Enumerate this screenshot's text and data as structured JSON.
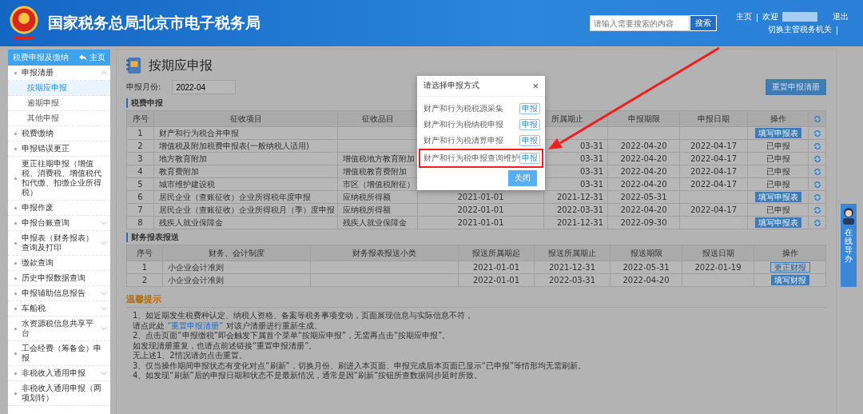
{
  "header": {
    "title": "国家税务总局北京市电子税务局",
    "search": {
      "placeholder": "请输入需要搜索的内容",
      "button": "搜索"
    },
    "links": {
      "home": "主页",
      "welcome": "欢迎",
      "logout": "退出",
      "switch": "切换主管税务机关",
      "separator": "|"
    }
  },
  "sidebar": {
    "title": "税费申报及缴纳",
    "home": "主页",
    "items": [
      {
        "label": "申报清册",
        "kind": "group",
        "expanded": true,
        "children": [
          {
            "label": "按期应申报",
            "selected": true
          },
          {
            "label": "逾期申报",
            "selected": false
          },
          {
            "label": "其他申报",
            "selected": false
          }
        ]
      },
      {
        "label": "税费缴纳",
        "kind": "link"
      },
      {
        "label": "申报错误更正",
        "kind": "link"
      },
      {
        "label": "更正往期申报（增值税、消费税、增值税代扣代缴、扣缴企业所得税）",
        "kind": "link"
      },
      {
        "label": "申报作废",
        "kind": "link"
      },
      {
        "label": "申报台账查询",
        "kind": "group",
        "expanded": false
      },
      {
        "label": "申报表（财务报表）查询及打印",
        "kind": "group",
        "expanded": false
      },
      {
        "label": "缴款查询",
        "kind": "link"
      },
      {
        "label": "历史申报数据查询",
        "kind": "link"
      },
      {
        "label": "申报辅助信息报告",
        "kind": "group",
        "expanded": false
      },
      {
        "label": "车船税",
        "kind": "group",
        "expanded": false
      },
      {
        "label": "水资源税信息共享平台",
        "kind": "group",
        "expanded": false
      },
      {
        "label": "工会经费（筹备金）申报",
        "kind": "link"
      },
      {
        "label": "非税收入通用申报",
        "kind": "group",
        "expanded": false
      },
      {
        "label": "非税收入通用申报（两项划转）",
        "kind": "link"
      }
    ]
  },
  "page": {
    "title": "按期应申报",
    "month_label": "申报月份:",
    "month": "2022-04",
    "reset_button": "重置申报清册"
  },
  "tax_section": {
    "title": "税费申报",
    "columns": [
      {
        "label": "序号"
      },
      {
        "label": "征收项目"
      },
      {
        "label": "征收品目"
      },
      {},
      {
        "label": "所属期止"
      },
      {
        "label": "申报期限"
      },
      {
        "label": "申报日期"
      },
      {
        "label": "操作"
      },
      {
        "kind": "refresh"
      }
    ],
    "rows": [
      {
        "no": "1",
        "item": "财产和行为税合并申报",
        "action": {
          "kind": "button",
          "label": "填写申报表"
        }
      },
      {
        "no": "2",
        "item": "增值税及附加税费申报表(一般纳税人适用)",
        "end": "03-31",
        "deadline": "2022-04-20",
        "date": "2022-04-17",
        "action": {
          "kind": "text",
          "label": "已申报"
        }
      },
      {
        "no": "3",
        "item": "地方教育附加",
        "sub": "增值税地方教育附加",
        "end": "03-31",
        "deadline": "2022-04-20",
        "date": "2022-04-17",
        "action": {
          "kind": "text",
          "label": "已申报"
        }
      },
      {
        "no": "4",
        "item": "教育费附加",
        "sub": "增值税教育费附加",
        "end": "03-31",
        "deadline": "2022-04-20",
        "date": "2022-04-17",
        "action": {
          "kind": "text",
          "label": "已申报"
        }
      },
      {
        "no": "5",
        "item": "城市维护建设税",
        "sub": "市区（增值税附征）",
        "end": "03-31",
        "deadline": "2022-04-20",
        "date": "2022-04-17",
        "action": {
          "kind": "text",
          "label": "已申报"
        }
      },
      {
        "no": "6",
        "item": "居民企业（查账征收）企业所得税年度申报",
        "sub": "应纳税所得额",
        "start": "2021-01-01",
        "end": "2021-12-31",
        "deadline": "2022-05-31",
        "action": {
          "kind": "button",
          "label": "填写申报表"
        }
      },
      {
        "no": "7",
        "item": "居民企业（查账征收）企业所得税月（季）度申报",
        "sub": "应纳税所得额",
        "start": "2022-01-01",
        "end": "2022-03-31",
        "deadline": "2022-04-20",
        "date": "2022-04-17",
        "action": {
          "kind": "text",
          "label": "已申报"
        }
      },
      {
        "no": "8",
        "item": "残疾人就业保障金",
        "sub": "残疾人就业保障金",
        "start": "2021-01-01",
        "end": "2021-12-31",
        "deadline": "2022-09-30",
        "action": {
          "kind": "button",
          "label": "填写申报表"
        }
      }
    ]
  },
  "report_section": {
    "title": "财务报表报送",
    "columns": [
      "序号",
      "财务、会计制度",
      "财务报表报送小类",
      "报送所属期起",
      "报送所属期止",
      "报送期限",
      "报送日期",
      "操作"
    ],
    "rows": [
      {
        "no": "1",
        "system": "小企业会计准则",
        "start": "2021-01-01",
        "end": "2021-12-31",
        "deadline": "2022-05-31",
        "date": "2022-01-19",
        "action": {
          "kind": "outline",
          "label": "更正财报"
        }
      },
      {
        "no": "2",
        "system": "小企业会计准则",
        "start": "2022-01-01",
        "end": "2022-03-31",
        "deadline": "2022-04-20",
        "action": {
          "kind": "filled",
          "label": "填写财报"
        }
      }
    ]
  },
  "tips": {
    "title": "温馨提示",
    "lines": [
      {
        "text": "1、如近期发生税费种认定、纳税人资格、备案等税务事项变动，页面展现信息与实际信息不符，"
      },
      {
        "before": "请点此处 ",
        "link": "“重置申报清册”",
        "after": " 对该户清册进行重新生成。"
      },
      {
        "text": "2、点击页面“申报缴税”即会触发下属首个菜单“按期应申报”，无需再点击“按期应申报”。"
      },
      {
        "text": "如发现清册重复，也请点前述链接“重置申报清册”。"
      },
      {
        "text": "无上述1、2情况请勿点击重置。"
      },
      {
        "text": "3、仅当操作期间申报状态有变化对点“刷新”，切换月份、刷进入本页面、申报完成后本页面已显示“已申报”等情形均无需刷新。"
      },
      {
        "text": "4、如发现“刷新”后的申报日期和状态不是最新情况，通常是因“刷新”按钮所查数据同步延时所致。"
      }
    ]
  },
  "dialog": {
    "title": "请选择申报方式",
    "close": "×",
    "options": [
      {
        "label": "财产和行为税税源采集",
        "button": "申报",
        "highlighted": false
      },
      {
        "label": "财产和行为税纳税申报",
        "button": "申报",
        "highlighted": false
      },
      {
        "label": "财产和行为税清算申报",
        "button": "申报",
        "highlighted": false
      },
      {
        "label": "财产和行为税申报查询维护",
        "button": "申报",
        "highlighted": true
      }
    ],
    "close_button": "关闭"
  },
  "help_widget": {
    "label": "在线导办"
  }
}
